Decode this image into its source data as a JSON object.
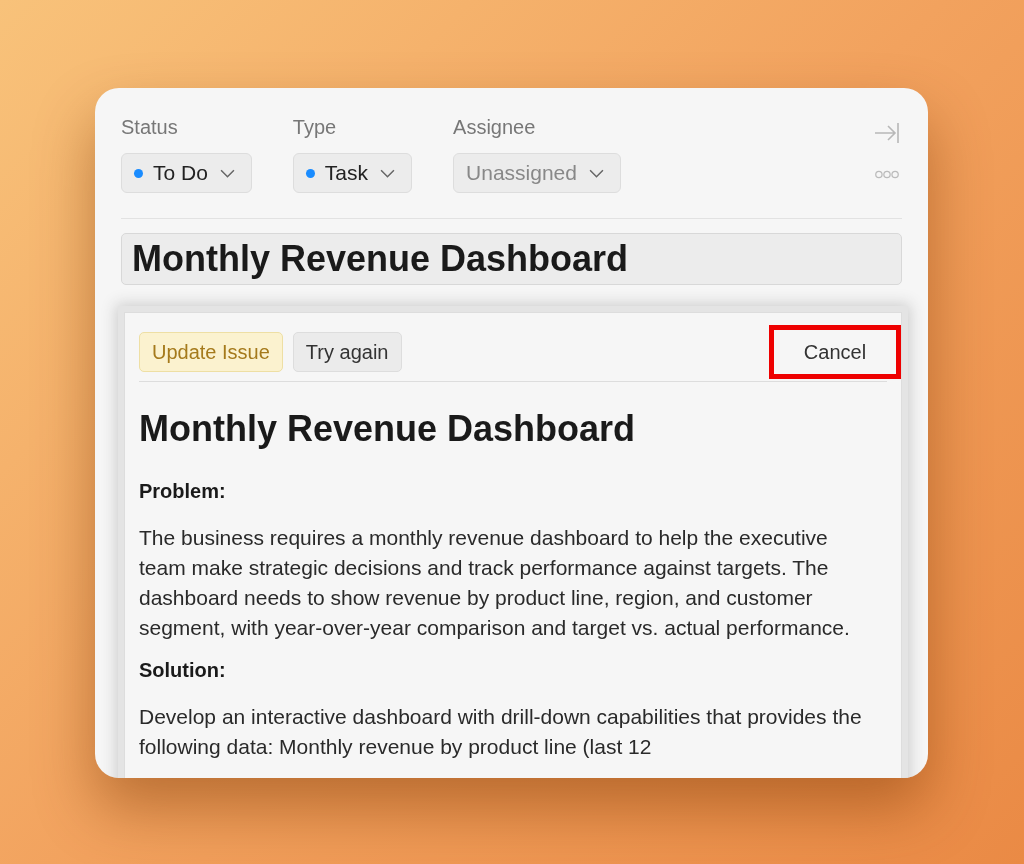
{
  "fields": [
    {
      "label": "Status",
      "value": "To Do",
      "color": "#1a8cff",
      "muted": false
    },
    {
      "label": "Type",
      "value": "Task",
      "color": "#1a8cff",
      "muted": false
    },
    {
      "label": "Assignee",
      "value": "Unassigned",
      "muted": true
    }
  ],
  "title": "Monthly Revenue Dashboard",
  "panel": {
    "buttons": [
      {
        "label": "Update Issue",
        "kind": "primary"
      },
      {
        "label": "Try again",
        "kind": "secondary"
      }
    ],
    "cancel": {
      "label": "Cancel",
      "highlighted": true
    },
    "heading": "Monthly Revenue Dashboard",
    "sections": [
      {
        "heading": "Problem:",
        "text": "The business requires a monthly revenue dashboard to help the executive team make strategic decisions and track performance against targets. The dashboard needs to show revenue by product line, region, and customer segment, with year-over-year comparison and target vs. actual performance."
      },
      {
        "heading": "Solution:",
        "text": "Develop an interactive dashboard with drill-down capabilities that provides the following data:  Monthly revenue by product line (last 12"
      }
    ]
  }
}
